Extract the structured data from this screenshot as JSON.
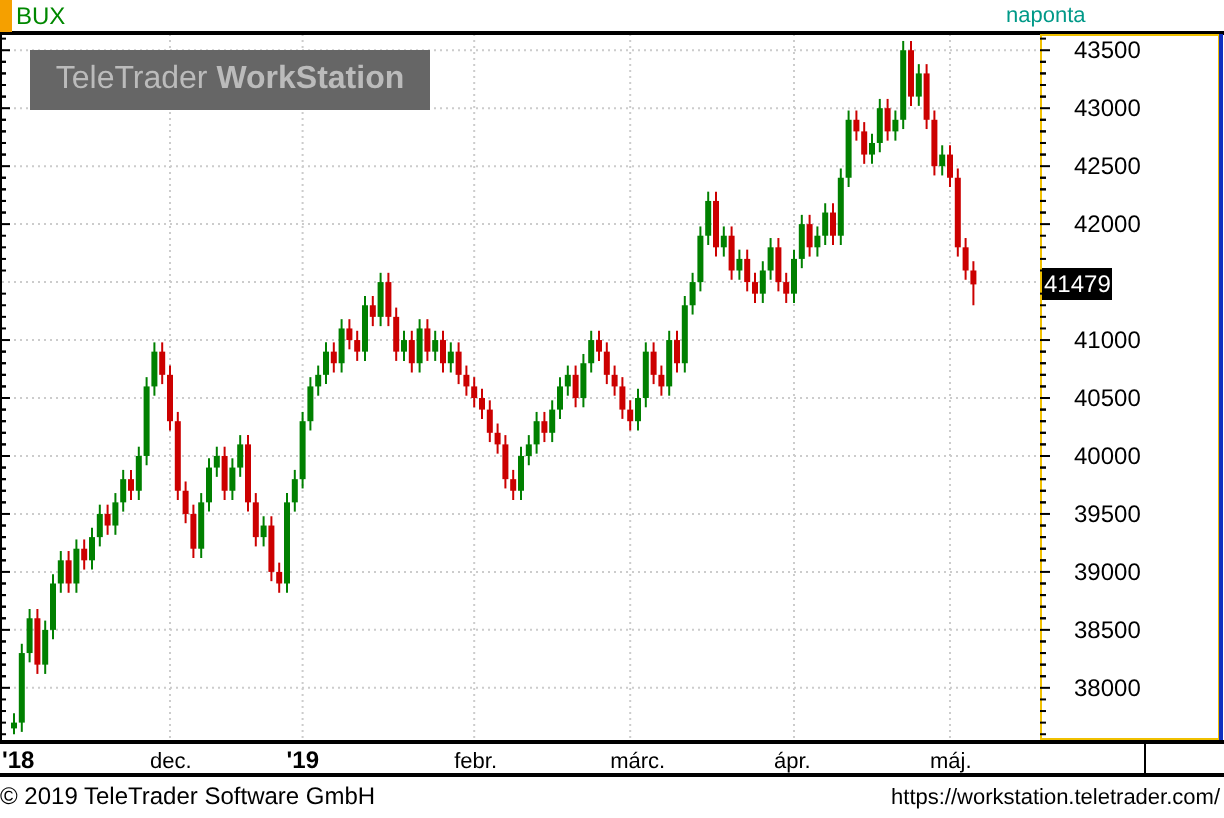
{
  "header": {
    "interval": "naponta"
  },
  "logo": {
    "text": "TeleTrader **WorkStation**"
  },
  "current_price": "41479",
  "chart_data": {
    "type": "candlestick",
    "title": "BUX",
    "grid": true,
    "ylim": [
      37550,
      43640
    ],
    "yticks": [
      38000,
      38500,
      39000,
      39500,
      40000,
      40500,
      41000,
      42000,
      42500,
      43000,
      43500
    ],
    "categories": [
      "'18",
      null,
      null,
      null,
      null,
      null,
      null,
      null,
      null,
      null,
      null,
      null,
      null,
      null,
      null,
      null,
      null,
      null,
      null,
      null,
      "dec.",
      null,
      null,
      null,
      null,
      null,
      null,
      null,
      null,
      null,
      null,
      null,
      null,
      null,
      null,
      null,
      null,
      "'19",
      null,
      null,
      null,
      null,
      null,
      null,
      null,
      null,
      null,
      null,
      null,
      null,
      null,
      null,
      null,
      null,
      null,
      null,
      null,
      null,
      null,
      "febr.",
      null,
      null,
      null,
      null,
      null,
      null,
      null,
      null,
      null,
      null,
      null,
      null,
      null,
      null,
      null,
      null,
      null,
      null,
      null,
      "márc.",
      null,
      null,
      null,
      null,
      null,
      null,
      null,
      null,
      null,
      null,
      null,
      null,
      null,
      null,
      null,
      null,
      null,
      null,
      null,
      null,
      "ápr.",
      null,
      null,
      null,
      null,
      null,
      null,
      null,
      null,
      null,
      null,
      null,
      null,
      null,
      null,
      null,
      null,
      null,
      null,
      null,
      "máj.",
      null,
      null,
      null
    ],
    "ohlc": [
      [
        37650,
        37780,
        37600,
        37700
      ],
      [
        37700,
        38380,
        37620,
        38300
      ],
      [
        38300,
        38680,
        38220,
        38600
      ],
      [
        38600,
        38680,
        38120,
        38200
      ],
      [
        38200,
        38580,
        38120,
        38500
      ],
      [
        38500,
        38980,
        38420,
        38900
      ],
      [
        38900,
        39180,
        38820,
        39100
      ],
      [
        39100,
        39180,
        38820,
        38900
      ],
      [
        38900,
        39280,
        38820,
        39200
      ],
      [
        39200,
        39280,
        39020,
        39100
      ],
      [
        39100,
        39380,
        39020,
        39300
      ],
      [
        39300,
        39580,
        39220,
        39500
      ],
      [
        39500,
        39580,
        39320,
        39400
      ],
      [
        39400,
        39680,
        39320,
        39600
      ],
      [
        39600,
        39880,
        39520,
        39800
      ],
      [
        39800,
        39880,
        39620,
        39700
      ],
      [
        39700,
        40080,
        39620,
        40000
      ],
      [
        40000,
        40680,
        39920,
        40600
      ],
      [
        40600,
        40980,
        40520,
        40900
      ],
      [
        40900,
        40980,
        40620,
        40700
      ],
      [
        40700,
        40780,
        40220,
        40300
      ],
      [
        40300,
        40380,
        39620,
        39700
      ],
      [
        39700,
        39780,
        39420,
        39500
      ],
      [
        39500,
        39580,
        39120,
        39200
      ],
      [
        39200,
        39680,
        39120,
        39600
      ],
      [
        39600,
        39980,
        39520,
        39900
      ],
      [
        39900,
        40080,
        39820,
        40000
      ],
      [
        40000,
        40080,
        39620,
        39700
      ],
      [
        39700,
        39980,
        39620,
        39900
      ],
      [
        39900,
        40180,
        39820,
        40100
      ],
      [
        40100,
        40180,
        39520,
        39600
      ],
      [
        39600,
        39680,
        39220,
        39300
      ],
      [
        39300,
        39480,
        39220,
        39400
      ],
      [
        39400,
        39480,
        38920,
        39000
      ],
      [
        39000,
        39080,
        38820,
        38900
      ],
      [
        38900,
        39680,
        38820,
        39600
      ],
      [
        39600,
        39880,
        39520,
        39800
      ],
      [
        39800,
        40380,
        39720,
        40300
      ],
      [
        40300,
        40680,
        40220,
        40600
      ],
      [
        40600,
        40780,
        40520,
        40700
      ],
      [
        40700,
        40980,
        40620,
        40900
      ],
      [
        40900,
        40980,
        40720,
        40800
      ],
      [
        40800,
        41180,
        40720,
        41100
      ],
      [
        41100,
        41180,
        40920,
        41000
      ],
      [
        41000,
        41080,
        40820,
        40900
      ],
      [
        40900,
        41380,
        40820,
        41300
      ],
      [
        41300,
        41380,
        41120,
        41200
      ],
      [
        41200,
        41580,
        41120,
        41500
      ],
      [
        41500,
        41580,
        41120,
        41200
      ],
      [
        41200,
        41280,
        40820,
        40900
      ],
      [
        40900,
        41080,
        40820,
        41000
      ],
      [
        41000,
        41080,
        40720,
        40800
      ],
      [
        40800,
        41180,
        40720,
        41100
      ],
      [
        41100,
        41180,
        40820,
        40900
      ],
      [
        40900,
        41080,
        40820,
        41000
      ],
      [
        41000,
        41080,
        40720,
        40800
      ],
      [
        40800,
        40980,
        40720,
        40900
      ],
      [
        40900,
        40980,
        40620,
        40700
      ],
      [
        40700,
        40780,
        40520,
        40600
      ],
      [
        40600,
        40680,
        40420,
        40500
      ],
      [
        40500,
        40580,
        40320,
        40400
      ],
      [
        40400,
        40480,
        40120,
        40200
      ],
      [
        40200,
        40280,
        40020,
        40100
      ],
      [
        40100,
        40180,
        39720,
        39800
      ],
      [
        39800,
        39880,
        39620,
        39700
      ],
      [
        39700,
        40080,
        39620,
        40000
      ],
      [
        40000,
        40180,
        39920,
        40100
      ],
      [
        40100,
        40380,
        40020,
        40300
      ],
      [
        40300,
        40380,
        40120,
        40200
      ],
      [
        40200,
        40480,
        40120,
        40400
      ],
      [
        40400,
        40680,
        40320,
        40600
      ],
      [
        40600,
        40780,
        40520,
        40700
      ],
      [
        40700,
        40780,
        40420,
        40500
      ],
      [
        40500,
        40880,
        40420,
        40800
      ],
      [
        40800,
        41080,
        40720,
        41000
      ],
      [
        41000,
        41080,
        40820,
        40900
      ],
      [
        40900,
        40980,
        40620,
        40700
      ],
      [
        40700,
        40780,
        40520,
        40600
      ],
      [
        40600,
        40680,
        40320,
        40400
      ],
      [
        40400,
        40480,
        40220,
        40300
      ],
      [
        40300,
        40580,
        40220,
        40500
      ],
      [
        40500,
        40980,
        40420,
        40900
      ],
      [
        40900,
        40980,
        40620,
        40700
      ],
      [
        40700,
        40780,
        40520,
        40600
      ],
      [
        40600,
        41080,
        40520,
        41000
      ],
      [
        41000,
        41080,
        40720,
        40800
      ],
      [
        40800,
        41380,
        40720,
        41300
      ],
      [
        41300,
        41580,
        41220,
        41500
      ],
      [
        41500,
        41980,
        41420,
        41900
      ],
      [
        41900,
        42280,
        41820,
        42200
      ],
      [
        42200,
        42280,
        41720,
        41800
      ],
      [
        41800,
        41980,
        41720,
        41900
      ],
      [
        41900,
        41980,
        41520,
        41600
      ],
      [
        41600,
        41780,
        41520,
        41700
      ],
      [
        41700,
        41780,
        41420,
        41500
      ],
      [
        41500,
        41580,
        41320,
        41400
      ],
      [
        41400,
        41680,
        41320,
        41600
      ],
      [
        41600,
        41880,
        41520,
        41800
      ],
      [
        41800,
        41880,
        41420,
        41500
      ],
      [
        41500,
        41580,
        41320,
        41400
      ],
      [
        41400,
        41780,
        41320,
        41700
      ],
      [
        41700,
        42080,
        41620,
        42000
      ],
      [
        42000,
        42080,
        41720,
        41800
      ],
      [
        41800,
        41980,
        41720,
        41900
      ],
      [
        41900,
        42180,
        41820,
        42100
      ],
      [
        42100,
        42180,
        41820,
        41900
      ],
      [
        41900,
        42480,
        41820,
        42400
      ],
      [
        42400,
        42980,
        42320,
        42900
      ],
      [
        42900,
        42980,
        42720,
        42800
      ],
      [
        42800,
        42880,
        42520,
        42600
      ],
      [
        42600,
        42780,
        42520,
        42700
      ],
      [
        42700,
        43080,
        42620,
        43000
      ],
      [
        43000,
        43080,
        42720,
        42800
      ],
      [
        42800,
        42980,
        42720,
        42900
      ],
      [
        42900,
        43580,
        42820,
        43500
      ],
      [
        43500,
        43580,
        43020,
        43100
      ],
      [
        43100,
        43380,
        43020,
        43300
      ],
      [
        43300,
        43380,
        42820,
        42900
      ],
      [
        42900,
        42980,
        42420,
        42500
      ],
      [
        42500,
        42680,
        42420,
        42600
      ],
      [
        42600,
        42680,
        42320,
        42400
      ],
      [
        42400,
        42480,
        41720,
        41800
      ],
      [
        41800,
        41880,
        41520,
        41600
      ],
      [
        41600,
        41680,
        41300,
        41480
      ]
    ]
  },
  "footer": {
    "copyright": "© 2019 TeleTrader Software GmbH",
    "url": "https://workstation.teletrader.com/"
  }
}
